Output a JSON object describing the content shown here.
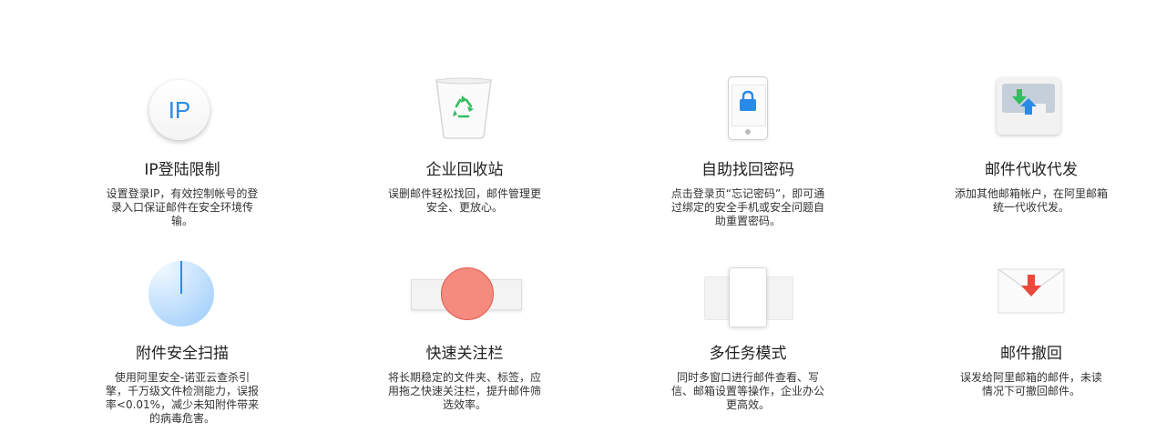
{
  "features": [
    {
      "title": "IP登陆限制",
      "desc": [
        "设置登录IP，有效控制帐号的登",
        "录入口保证邮件在安全环境传",
        "输。"
      ],
      "icon_text": "IP",
      "icon": "ip-icon"
    },
    {
      "title": "企业回收站",
      "desc": [
        "误删邮件轻松找回，邮件管理更",
        "安全、更放心。"
      ],
      "icon": "recycle-bin-icon"
    },
    {
      "title": "自助找回密码",
      "desc": [
        "点击登录页“忘记密码”，即可通",
        "过绑定的安全手机或安全问题自",
        "助重置密码。"
      ],
      "icon": "phone-lock-icon"
    },
    {
      "title": "邮件代收代发",
      "desc": [
        "添加其他邮箱帐户，在阿里邮箱",
        "统一代收代发。"
      ],
      "icon": "mail-forward-icon"
    },
    {
      "title": "附件安全扫描",
      "desc": [
        "使用阿里安全-诺亚云查杀引",
        "擎，千万级文件检测能力，误报",
        "率<0.01%，减少未知附件带来",
        "的病毒危害。"
      ],
      "icon": "scan-pie-icon"
    },
    {
      "title": "快速关注栏",
      "desc": [
        "将长期稳定的文件夹、标签，应",
        "用拖之快速关注栏，提升邮件筛",
        "选效率。"
      ],
      "icon": "quick-bar-icon"
    },
    {
      "title": "多任务模式",
      "desc": [
        "同时多窗口进行邮件查看、写",
        "信、邮箱设置等操作，企业办公",
        "更高效。"
      ],
      "icon": "multitask-icon"
    },
    {
      "title": "邮件撤回",
      "desc": [
        "误发给阿里邮箱的邮件，未读",
        "情况下可撤回邮件。"
      ],
      "icon": "recall-envelope-icon"
    }
  ],
  "colors": {
    "blue": "#2a8ae8",
    "green": "#2fbf5f",
    "red": "#e9483b"
  }
}
